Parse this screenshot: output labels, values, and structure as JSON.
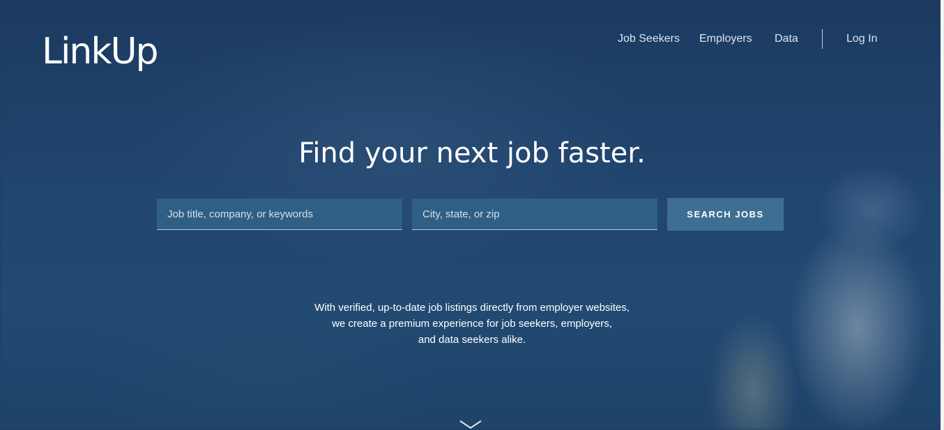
{
  "header": {
    "logo_text": "LinkUp",
    "nav": [
      {
        "label": "Job Seekers"
      },
      {
        "label": "Employers"
      },
      {
        "label": "Data"
      },
      {
        "label": "Log In"
      }
    ]
  },
  "hero": {
    "headline": "Find your next job faster.",
    "search": {
      "keywords_placeholder": "Job title, company, or keywords",
      "keywords_value": "",
      "location_placeholder": "City, state, or zip",
      "location_value": "",
      "button_label": "SEARCH JOBS"
    },
    "tagline_lines": [
      "With verified, up-to-date job listings directly from employer websites,",
      "we create a premium experience for job seekers, employers,",
      "and data seekers alike."
    ]
  },
  "icons": {
    "scroll_down": "chevron-down-icon"
  },
  "colors": {
    "background": "#1d3d63",
    "input_bg": "#2f5f85",
    "button_bg": "#3e6f93",
    "text": "#ffffff"
  }
}
